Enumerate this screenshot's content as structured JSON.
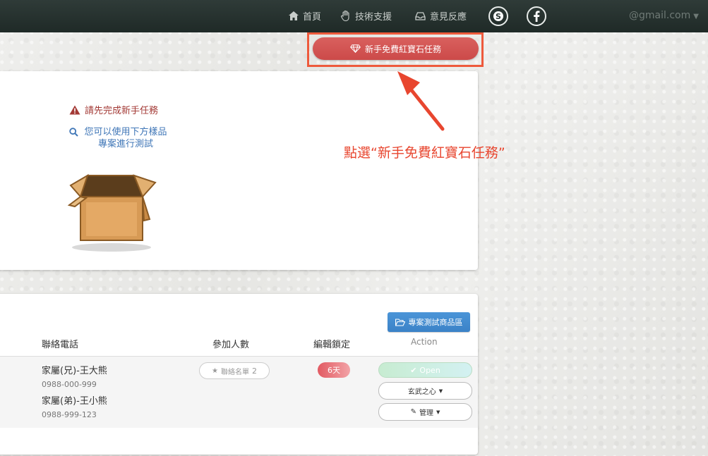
{
  "nav": {
    "home_label": "首頁",
    "support_label": "技術支援",
    "feedback_label": "意見反應",
    "account_label": "@gmail.com"
  },
  "mission_button": {
    "label": "新手免費紅寶石任務"
  },
  "notice": {
    "warning": "請先完成新手任務",
    "hint": "您可以使用下方樣品專案進行測試"
  },
  "annotation": {
    "text": "點選“新手免費紅寶石任務”"
  },
  "projects": {
    "test_area_button": "專案測試商品區",
    "columns": {
      "phone": "聯絡電話",
      "participants": "參加人數",
      "edit_lock": "編輯鎖定",
      "action": "Action"
    },
    "row": {
      "contacts": [
        {
          "name": "家屬(兄)-王大熊",
          "phone": "0988-000-999"
        },
        {
          "name": "家屬(弟)-王小熊",
          "phone": "0988-999-123"
        }
      ],
      "contact_list_label": "聯絡名單",
      "contact_list_count": "2",
      "lock_days": "6天",
      "open_label": "Open",
      "select_label": "玄武之心",
      "manage_label": "管理"
    }
  },
  "colors": {
    "topbar": "#27332f",
    "mission_red": "#d3544f",
    "annotation_red": "#e8462f",
    "accent_blue": "#3f86ca"
  }
}
